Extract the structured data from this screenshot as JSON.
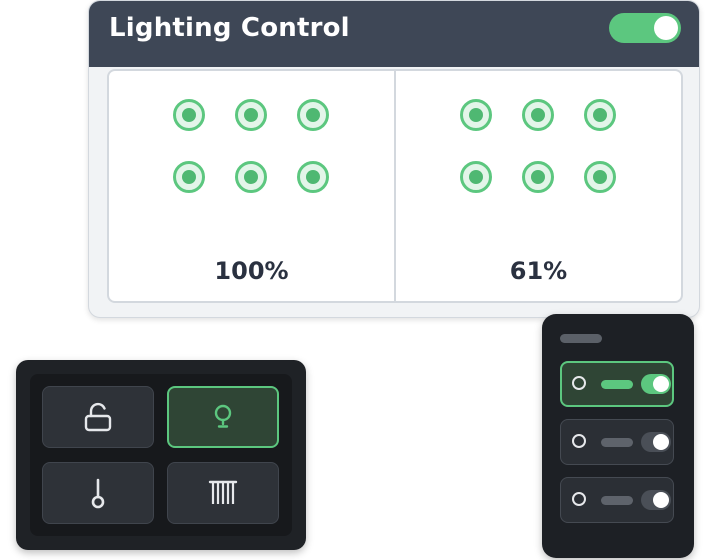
{
  "lighting": {
    "title": "Lighting Control",
    "master_on": true,
    "zones": [
      {
        "level": "100%",
        "lights": 6
      },
      {
        "level": "61%",
        "lights": 6
      }
    ]
  },
  "quick_panel": {
    "tiles": [
      {
        "icon": "unlocked-padlock-icon",
        "active": false
      },
      {
        "icon": "lightbulb-icon",
        "active": true
      },
      {
        "icon": "thermometer-icon",
        "active": false
      },
      {
        "icon": "radiator-icon",
        "active": false
      }
    ]
  },
  "scene_panel": {
    "rows": [
      {
        "active": true,
        "switch_on": true
      },
      {
        "active": false,
        "switch_on": true
      },
      {
        "active": false,
        "switch_on": true
      }
    ]
  },
  "colors": {
    "accent_green": "#5cc77f",
    "header_dark": "#3e4756",
    "panel_dark": "#1f2226"
  }
}
